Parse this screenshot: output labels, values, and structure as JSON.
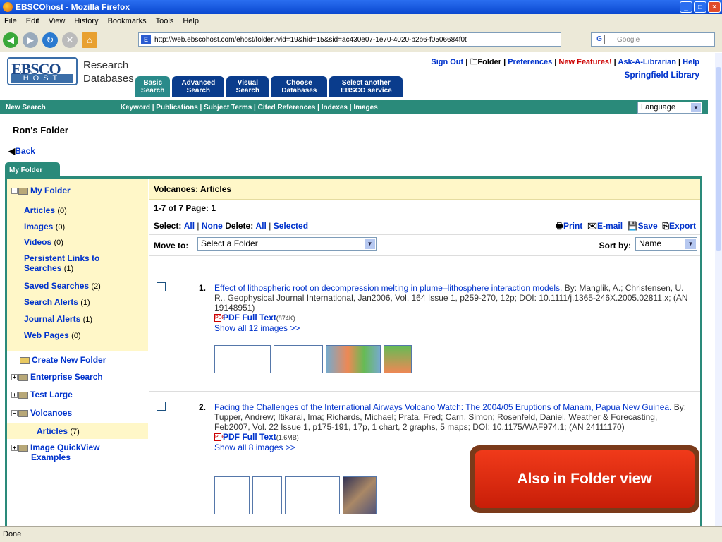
{
  "window": {
    "title": "EBSCOhost - Mozilla Firefox"
  },
  "menu": [
    "File",
    "Edit",
    "View",
    "History",
    "Bookmarks",
    "Tools",
    "Help"
  ],
  "address": {
    "url": "http://web.ebscohost.com/ehost/folder?vid=19&hid=15&sid=ac430e07-1e70-4020-b2b6-f0506684f0t",
    "search_placeholder": "Google"
  },
  "header": {
    "logo_top": "EBSCO",
    "logo_bottom": "HOST",
    "logo_text1": "Research",
    "logo_text2": "Databases",
    "tabs": [
      {
        "l1": "Basic",
        "l2": "Search"
      },
      {
        "l1": "Advanced",
        "l2": "Search"
      },
      {
        "l1": "Visual",
        "l2": "Search"
      },
      {
        "l1": "Choose",
        "l2": "Databases"
      },
      {
        "l1": "Select another",
        "l2": "EBSCO service"
      }
    ],
    "links": {
      "signout": "Sign Out",
      "folder": "Folder",
      "preferences": "Preferences",
      "newfeatures": "New Features!",
      "ask": "Ask-A-Librarian",
      "help": "Help"
    },
    "library": "Springfield Library"
  },
  "greenbar": {
    "new_search": "New Search",
    "keyword": "Keyword",
    "publications": "Publications",
    "subject_terms": "Subject Terms",
    "cited": "Cited References",
    "indexes": "Indexes",
    "images": "Images",
    "language": "Language"
  },
  "folder_title": "Ron's Folder",
  "back": "Back",
  "my_folder_tab": "My Folder",
  "sidebar": {
    "my_folder": "My Folder",
    "items": [
      {
        "label": "Articles",
        "count": "(0)"
      },
      {
        "label": "Images",
        "count": "(0)"
      },
      {
        "label": "Videos",
        "count": "(0)"
      },
      {
        "label": "Persistent Links to",
        "label2": "Searches",
        "count": "(1)"
      },
      {
        "label": "Saved Searches",
        "count": "(2)"
      },
      {
        "label": "Search Alerts",
        "count": "(1)"
      },
      {
        "label": "Journal Alerts",
        "count": "(1)"
      },
      {
        "label": "Web Pages",
        "count": "(0)"
      }
    ],
    "create": "Create New Folder",
    "enterprise": "Enterprise Search",
    "testlarge": "Test Large",
    "volcanoes": "Volcanoes",
    "vol_articles": "Articles",
    "vol_count": "(7)",
    "quickview1": "Image QuickView",
    "quickview2": "Examples"
  },
  "main": {
    "heading": "Volcanoes: Articles",
    "pagination": "1-7 of 7  Page: 1",
    "select_lbl": "Select:",
    "all": "All",
    "none": "None",
    "delete_lbl": "Delete:",
    "all2": "All",
    "selected": "Selected",
    "print": "Print",
    "email": "E-mail",
    "save": "Save",
    "export": "Export",
    "move_lbl": "Move to:",
    "move_value": "Select a Folder",
    "sort_lbl": "Sort by:",
    "sort_value": "Name",
    "results": [
      {
        "num": "1.",
        "title": "Effect of lithospheric root on decompression melting in plume–lithosphere interaction models.",
        "rest": " By: Manglik, A.; Christensen, U. R.. Geophysical Journal International, Jan2006, Vol. 164 Issue 1, p259-270, 12p; DOI: 10.1111/j.1365-246X.2005.02811.x; (AN 19148951)",
        "pdf": "PDF Full Text",
        "size": "(874K)",
        "show": "Show all 12 images >>"
      },
      {
        "num": "2.",
        "title": "Facing the Challenges of the International Airways Volcano Watch: The 2004/05 Eruptions of Manam, Papua New Guinea.",
        "rest": " By: Tupper, Andrew; Itikarai, Ima; Richards, Michael; Prata, Fred; Carn, Simon; Rosenfeld, Daniel. Weather & Forecasting, Feb2007, Vol. 22 Issue 1, p175-191, 17p, 1 chart, 2 graphs, 5 maps; DOI: 10.1175/WAF974.1; (AN 24111170)",
        "pdf": "PDF Full Text",
        "size": "(1.6MB)",
        "show": "Show all 8 images >>"
      }
    ]
  },
  "callout": "Also in Folder view",
  "status": "Done"
}
